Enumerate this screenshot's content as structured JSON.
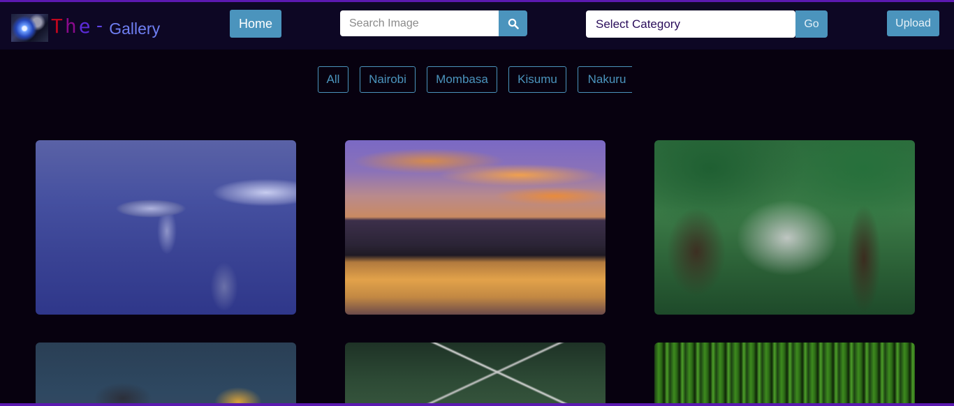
{
  "brand": {
    "the_letters": [
      "T",
      "h",
      "e"
    ],
    "dash": "-",
    "gallery": "Gallery"
  },
  "nav": {
    "home_label": "Home",
    "search_placeholder": "Search Image",
    "category_selected": "Select Category",
    "go_label": "Go",
    "upload_label": "Upload"
  },
  "filters": [
    "All",
    "Nairobi",
    "Mombasa",
    "Kisumu",
    "Nakuru"
  ],
  "colors": {
    "accent": "#4b94bd",
    "background": "#07010f",
    "navbar": "#0d0724",
    "border_line": "#5b19b0"
  },
  "icons": {
    "search": "search-icon",
    "logo": "logo-image"
  },
  "gallery": {
    "images": [
      {
        "subject": "dolphins"
      },
      {
        "subject": "sunset-lake"
      },
      {
        "subject": "forest-trees"
      },
      {
        "subject": "mountains"
      },
      {
        "subject": "rope-bridge"
      },
      {
        "subject": "bamboo-forest"
      }
    ]
  }
}
